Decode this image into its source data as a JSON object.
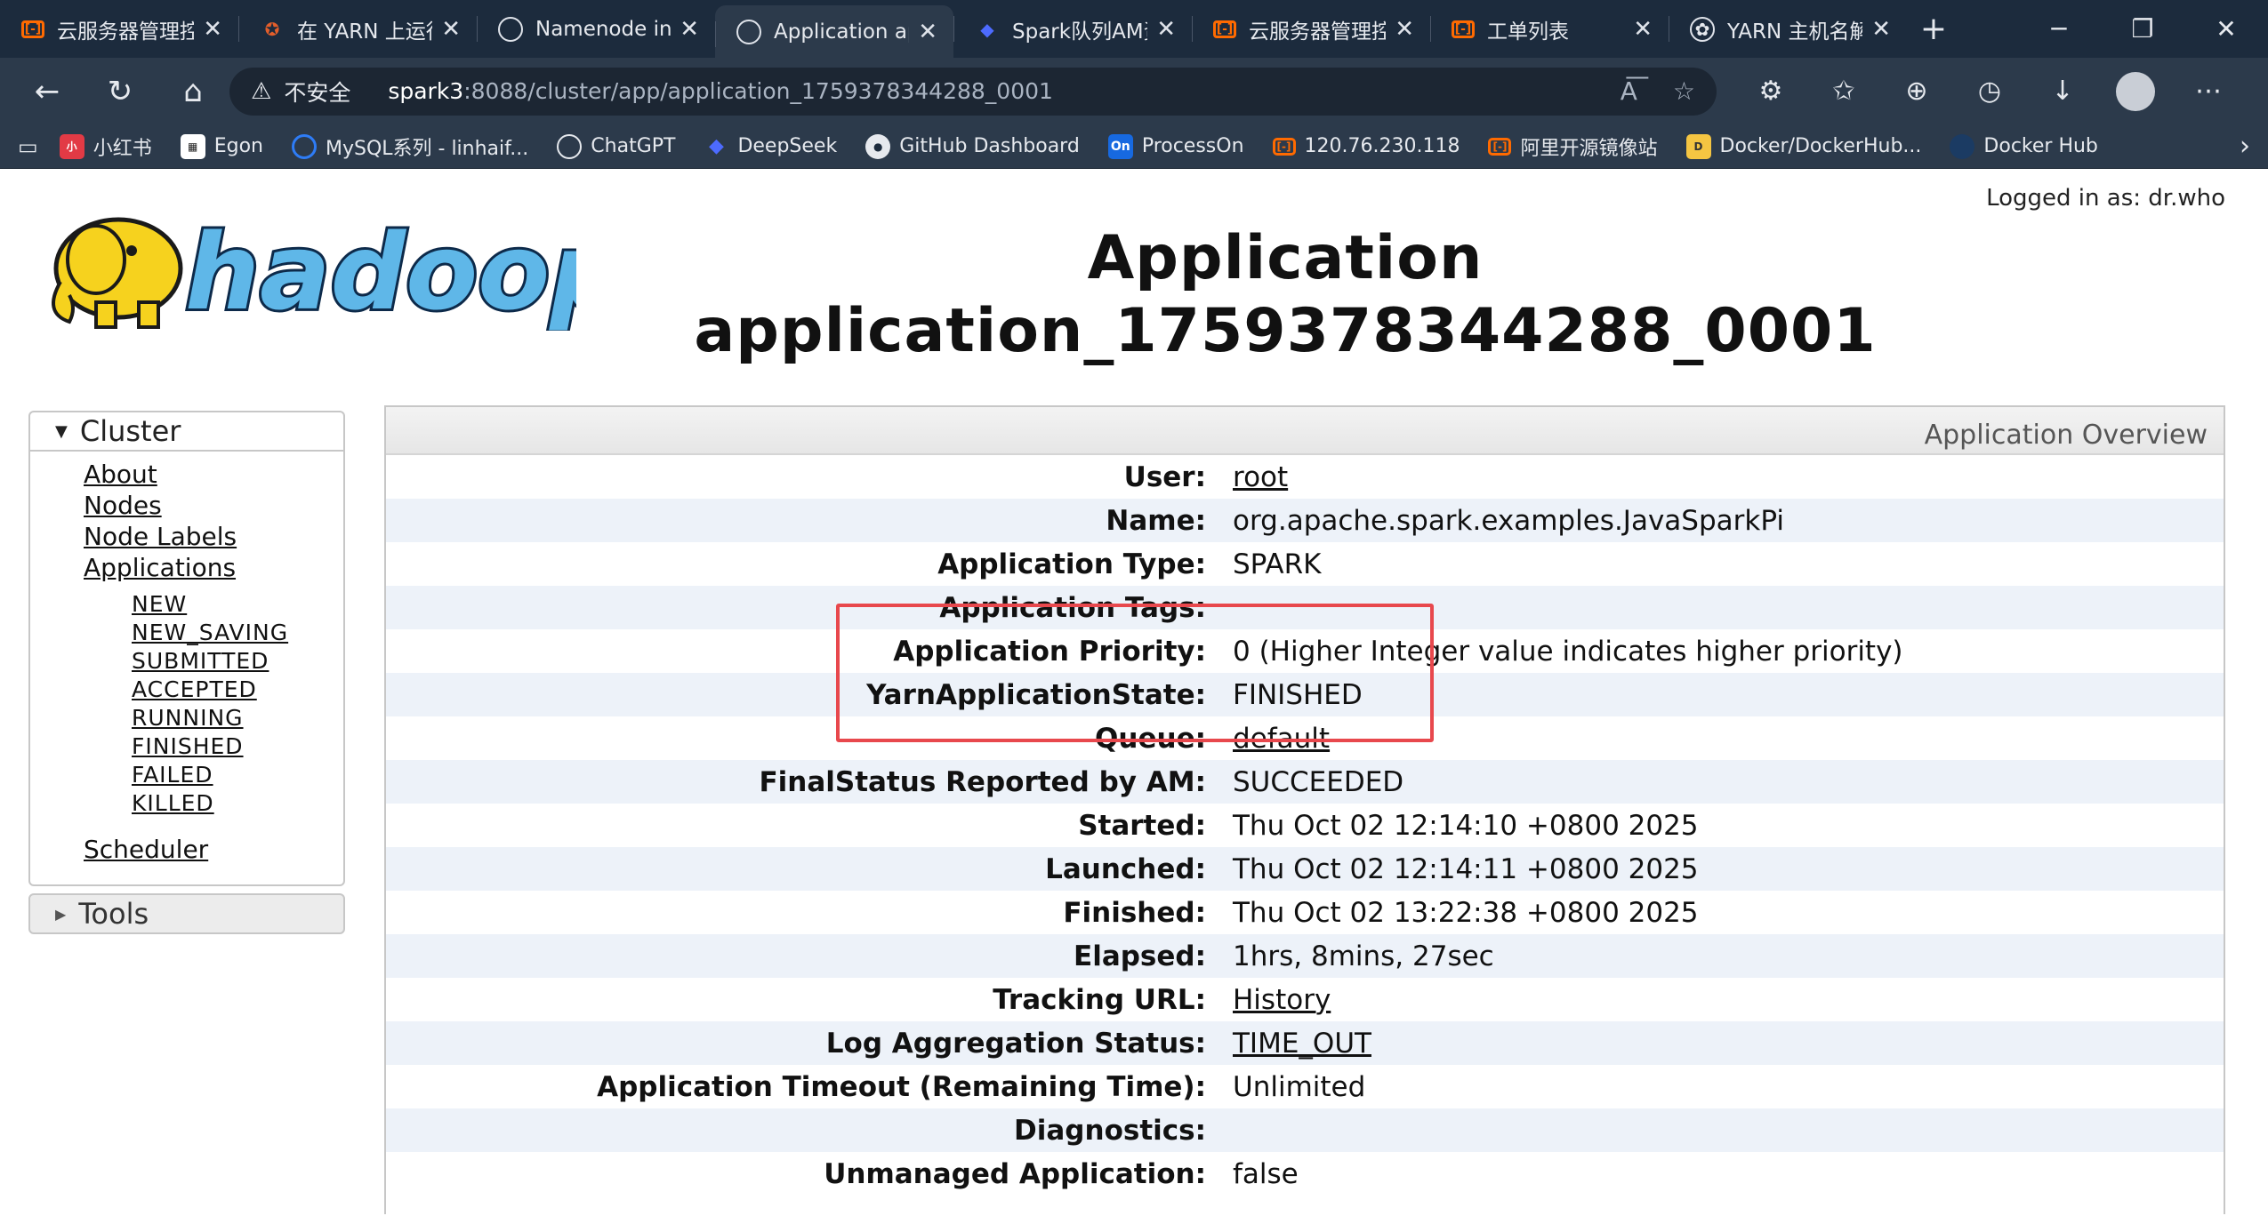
{
  "browser": {
    "tabs": [
      {
        "title": "云服务器管理控",
        "icon": "aliyun-icon"
      },
      {
        "title": "在 YARN 上运行",
        "icon": "star-icon"
      },
      {
        "title": "Namenode info",
        "icon": "globe-icon"
      },
      {
        "title": "Application app",
        "icon": "globe-icon",
        "active": true
      },
      {
        "title": "Spark队列AM资",
        "icon": "deepseek-icon"
      },
      {
        "title": "云服务器管理控",
        "icon": "aliyun-icon"
      },
      {
        "title": "工单列表",
        "icon": "aliyun-icon"
      },
      {
        "title": "YARN 主机名解",
        "icon": "chatgpt-icon"
      }
    ],
    "address": {
      "security_label": "不安全",
      "host": "spark3",
      "path": ":8088/cluster/app/application_1759378344288_0001"
    },
    "bookmarks": [
      {
        "label": "小红书",
        "icon": "xiaohongshu-icon"
      },
      {
        "label": "Egon",
        "icon": "grid-icon"
      },
      {
        "label": "MySQL系列 - linhaif...",
        "icon": "mysql-icon"
      },
      {
        "label": "ChatGPT",
        "icon": "chatgpt-icon"
      },
      {
        "label": "DeepSeek",
        "icon": "deepseek-icon"
      },
      {
        "label": "GitHub Dashboard",
        "icon": "github-icon"
      },
      {
        "label": "ProcessOn",
        "icon": "processon-icon"
      },
      {
        "label": "120.76.230.118",
        "icon": "aliyun-icon"
      },
      {
        "label": "阿里开源镜像站",
        "icon": "aliyun-icon"
      },
      {
        "label": "Docker/DockerHub...",
        "icon": "docker-icon"
      },
      {
        "label": "Docker Hub",
        "icon": "dockerhub-icon"
      }
    ]
  },
  "page": {
    "logged_in": "Logged in as: dr.who",
    "title_line1": "Application",
    "title_line2": "application_1759378344288_0001"
  },
  "sidebar": {
    "cluster_label": "Cluster",
    "links": [
      "About",
      "Nodes",
      "Node Labels",
      "Applications"
    ],
    "app_states": [
      "NEW",
      "NEW_SAVING",
      "SUBMITTED",
      "ACCEPTED",
      "RUNNING",
      "FINISHED",
      "FAILED",
      "KILLED"
    ],
    "scheduler": "Scheduler",
    "tools_label": "Tools"
  },
  "overview": {
    "header": "Application Overview",
    "rows": [
      {
        "key": "User:",
        "value": "root",
        "link": true
      },
      {
        "key": "Name:",
        "value": "org.apache.spark.examples.JavaSparkPi"
      },
      {
        "key": "Application Type:",
        "value": "SPARK"
      },
      {
        "key": "Application Tags:",
        "value": ""
      },
      {
        "key": "Application Priority:",
        "value": "0 (Higher Integer value indicates higher priority)"
      },
      {
        "key": "YarnApplicationState:",
        "value": "FINISHED"
      },
      {
        "key": "Queue:",
        "value": "default",
        "link": true
      },
      {
        "key": "FinalStatus Reported by AM:",
        "value": "SUCCEEDED"
      },
      {
        "key": "Started:",
        "value": "Thu Oct 02 12:14:10 +0800 2025"
      },
      {
        "key": "Launched:",
        "value": "Thu Oct 02 12:14:11 +0800 2025"
      },
      {
        "key": "Finished:",
        "value": "Thu Oct 02 13:22:38 +0800 2025"
      },
      {
        "key": "Elapsed:",
        "value": "1hrs, 8mins, 27sec"
      },
      {
        "key": "Tracking URL:",
        "value": "History",
        "link": true
      },
      {
        "key": "Log Aggregation Status:",
        "value": "TIME_OUT",
        "link": true
      },
      {
        "key": "Application Timeout (Remaining Time):",
        "value": "Unlimited"
      },
      {
        "key": "Diagnostics:",
        "value": ""
      },
      {
        "key": "Unmanaged Application:",
        "value": "false"
      }
    ]
  },
  "colors": {
    "highlight": "#e8484d",
    "tabbar": "#1c2b3d",
    "toolbar": "#2c3a4b",
    "row_alt": "#edf2f9"
  }
}
